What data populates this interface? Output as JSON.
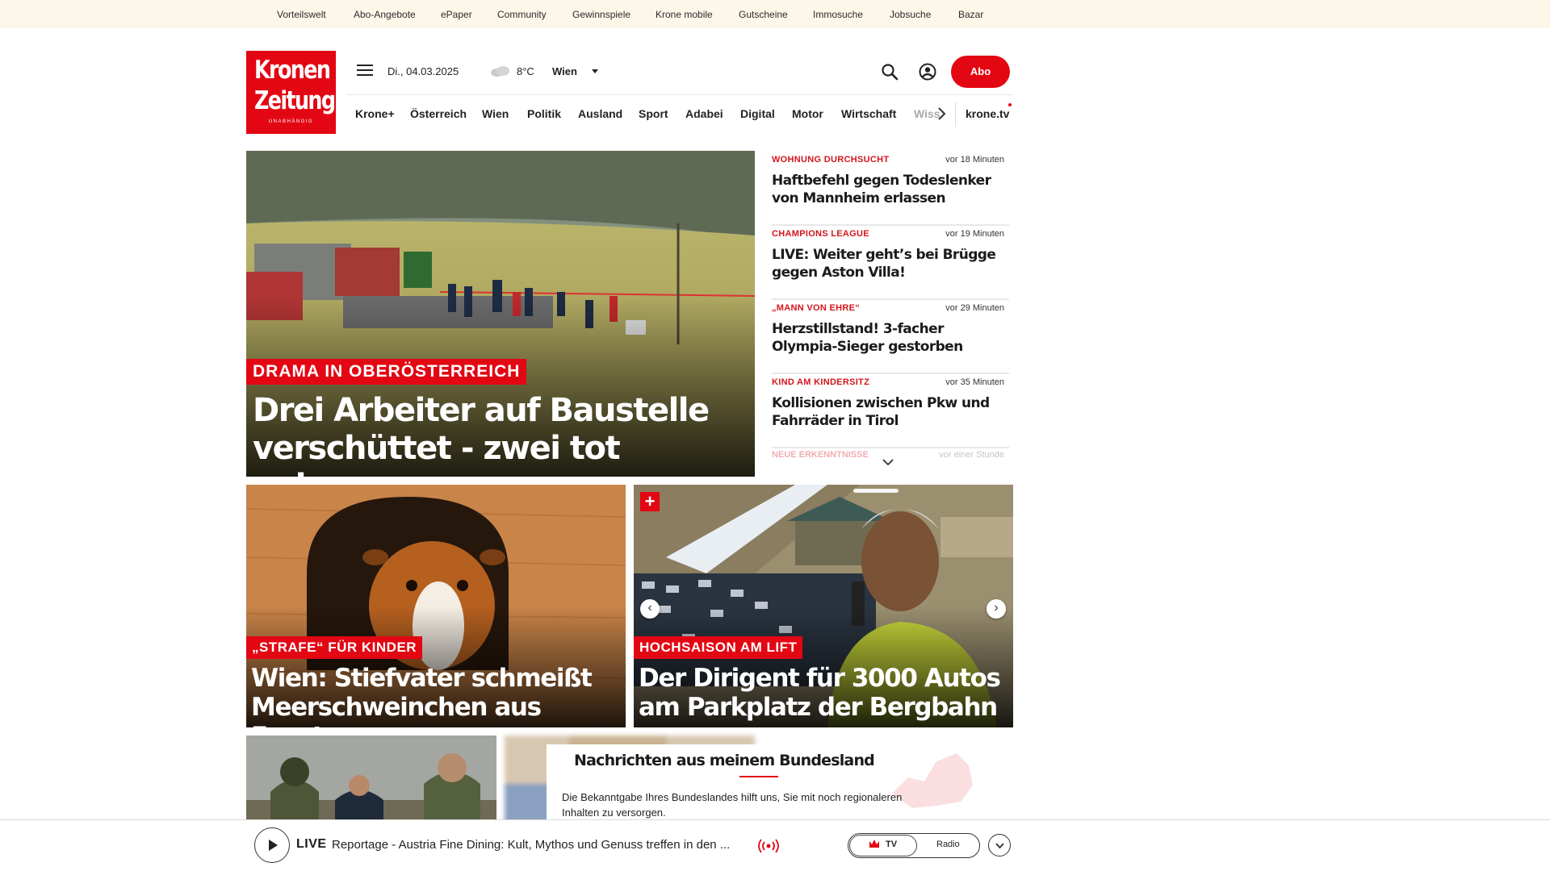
{
  "topbar": {
    "links": [
      "Vorteilswelt",
      "Abo-Angebote",
      "ePaper",
      "Community",
      "Gewinnspiele",
      "Krone mobile",
      "Gutscheine",
      "Immosuche",
      "Jobsuche",
      "Bazar"
    ]
  },
  "header": {
    "logo": {
      "line1": "Kronen",
      "line2": "Zeitung",
      "line3": "UNABHÄNGIG"
    },
    "date": "Di., 04.03.2025",
    "weather_icon": "cloud-icon",
    "temperature": "8°C",
    "city": "Wien",
    "abo_label": "Abo"
  },
  "nav": {
    "items": [
      "Krone+",
      "Österreich",
      "Wien",
      "Politik",
      "Ausland",
      "Sport",
      "Adabei",
      "Digital",
      "Motor",
      "Wirtschaft"
    ],
    "truncated": "Wiss",
    "tv": "krone.tv"
  },
  "hero": {
    "tag": "DRAMA IN OBERÖSTERREICH",
    "title": "Drei Arbeiter auf Baustelle verschüttet - zwei tot geborgen"
  },
  "sidebar": {
    "items": [
      {
        "tag": "WOHNUNG DURCHSUCHT",
        "time": "vor 18 Minuten",
        "title": "Haftbefehl gegen Todeslenker von Mannheim erlassen"
      },
      {
        "tag": "CHAMPIONS LEAGUE",
        "time": "vor 19 Minuten",
        "title": "LIVE: Weiter geht’s bei Brügge gegen Aston Villa!"
      },
      {
        "tag": "„MANN VON EHRE“",
        "time": "vor 29 Minuten",
        "title": "Herzstillstand! 3-facher Olympia-Sieger gestorben"
      },
      {
        "tag": "KIND AM KINDERSITZ",
        "time": "vor 35 Minuten",
        "title": "Kollisionen zwischen Pkw und Fahrräder in Tirol"
      }
    ],
    "faded": {
      "tag": "NEUE ERKENNTNISSE",
      "time": "vor einer Stunde"
    }
  },
  "cards": [
    {
      "tag": "„STRAFE“ FÜR KINDER",
      "title": "Wien: Stiefvater schmeißt Meerschweinchen aus Fenster"
    },
    {
      "tag": "HOCHSAISON AM LIFT",
      "title": "Der Dirigent für 3000 Autos am Parkplatz der Bergbahn",
      "badge": "+"
    }
  ],
  "bundesland": {
    "title": "Nachrichten aus meinem Bundesland",
    "text": "Die Bekanntgabe Ihres Bundeslandes hilft uns, Sie mit noch regionaleren Inhalten zu versorgen."
  },
  "player": {
    "live_label": "LIVE",
    "text": "Reportage - Austria Fine Dining: Kult, Mythos und Genuss treffen in den ...",
    "tv_label": "TV",
    "radio_label": "Radio"
  },
  "colors": {
    "brand": "#e30613",
    "topbar_bg": "#fdf7e9"
  }
}
